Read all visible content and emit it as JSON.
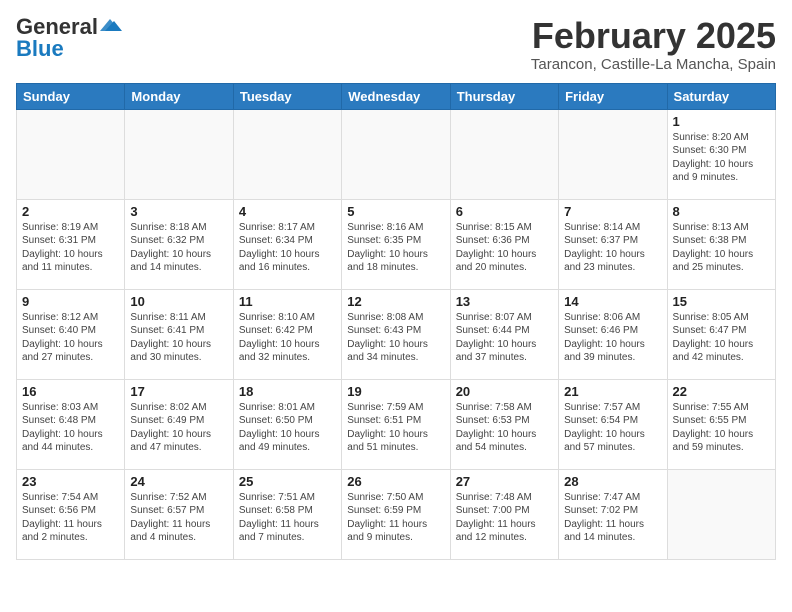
{
  "header": {
    "logo_general": "General",
    "logo_blue": "Blue",
    "month_year": "February 2025",
    "location": "Tarancon, Castille-La Mancha, Spain"
  },
  "weekdays": [
    "Sunday",
    "Monday",
    "Tuesday",
    "Wednesday",
    "Thursday",
    "Friday",
    "Saturday"
  ],
  "weeks": [
    [
      {
        "day": "",
        "info": ""
      },
      {
        "day": "",
        "info": ""
      },
      {
        "day": "",
        "info": ""
      },
      {
        "day": "",
        "info": ""
      },
      {
        "day": "",
        "info": ""
      },
      {
        "day": "",
        "info": ""
      },
      {
        "day": "1",
        "info": "Sunrise: 8:20 AM\nSunset: 6:30 PM\nDaylight: 10 hours and 9 minutes."
      }
    ],
    [
      {
        "day": "2",
        "info": "Sunrise: 8:19 AM\nSunset: 6:31 PM\nDaylight: 10 hours and 11 minutes."
      },
      {
        "day": "3",
        "info": "Sunrise: 8:18 AM\nSunset: 6:32 PM\nDaylight: 10 hours and 14 minutes."
      },
      {
        "day": "4",
        "info": "Sunrise: 8:17 AM\nSunset: 6:34 PM\nDaylight: 10 hours and 16 minutes."
      },
      {
        "day": "5",
        "info": "Sunrise: 8:16 AM\nSunset: 6:35 PM\nDaylight: 10 hours and 18 minutes."
      },
      {
        "day": "6",
        "info": "Sunrise: 8:15 AM\nSunset: 6:36 PM\nDaylight: 10 hours and 20 minutes."
      },
      {
        "day": "7",
        "info": "Sunrise: 8:14 AM\nSunset: 6:37 PM\nDaylight: 10 hours and 23 minutes."
      },
      {
        "day": "8",
        "info": "Sunrise: 8:13 AM\nSunset: 6:38 PM\nDaylight: 10 hours and 25 minutes."
      }
    ],
    [
      {
        "day": "9",
        "info": "Sunrise: 8:12 AM\nSunset: 6:40 PM\nDaylight: 10 hours and 27 minutes."
      },
      {
        "day": "10",
        "info": "Sunrise: 8:11 AM\nSunset: 6:41 PM\nDaylight: 10 hours and 30 minutes."
      },
      {
        "day": "11",
        "info": "Sunrise: 8:10 AM\nSunset: 6:42 PM\nDaylight: 10 hours and 32 minutes."
      },
      {
        "day": "12",
        "info": "Sunrise: 8:08 AM\nSunset: 6:43 PM\nDaylight: 10 hours and 34 minutes."
      },
      {
        "day": "13",
        "info": "Sunrise: 8:07 AM\nSunset: 6:44 PM\nDaylight: 10 hours and 37 minutes."
      },
      {
        "day": "14",
        "info": "Sunrise: 8:06 AM\nSunset: 6:46 PM\nDaylight: 10 hours and 39 minutes."
      },
      {
        "day": "15",
        "info": "Sunrise: 8:05 AM\nSunset: 6:47 PM\nDaylight: 10 hours and 42 minutes."
      }
    ],
    [
      {
        "day": "16",
        "info": "Sunrise: 8:03 AM\nSunset: 6:48 PM\nDaylight: 10 hours and 44 minutes."
      },
      {
        "day": "17",
        "info": "Sunrise: 8:02 AM\nSunset: 6:49 PM\nDaylight: 10 hours and 47 minutes."
      },
      {
        "day": "18",
        "info": "Sunrise: 8:01 AM\nSunset: 6:50 PM\nDaylight: 10 hours and 49 minutes."
      },
      {
        "day": "19",
        "info": "Sunrise: 7:59 AM\nSunset: 6:51 PM\nDaylight: 10 hours and 51 minutes."
      },
      {
        "day": "20",
        "info": "Sunrise: 7:58 AM\nSunset: 6:53 PM\nDaylight: 10 hours and 54 minutes."
      },
      {
        "day": "21",
        "info": "Sunrise: 7:57 AM\nSunset: 6:54 PM\nDaylight: 10 hours and 57 minutes."
      },
      {
        "day": "22",
        "info": "Sunrise: 7:55 AM\nSunset: 6:55 PM\nDaylight: 10 hours and 59 minutes."
      }
    ],
    [
      {
        "day": "23",
        "info": "Sunrise: 7:54 AM\nSunset: 6:56 PM\nDaylight: 11 hours and 2 minutes."
      },
      {
        "day": "24",
        "info": "Sunrise: 7:52 AM\nSunset: 6:57 PM\nDaylight: 11 hours and 4 minutes."
      },
      {
        "day": "25",
        "info": "Sunrise: 7:51 AM\nSunset: 6:58 PM\nDaylight: 11 hours and 7 minutes."
      },
      {
        "day": "26",
        "info": "Sunrise: 7:50 AM\nSunset: 6:59 PM\nDaylight: 11 hours and 9 minutes."
      },
      {
        "day": "27",
        "info": "Sunrise: 7:48 AM\nSunset: 7:00 PM\nDaylight: 11 hours and 12 minutes."
      },
      {
        "day": "28",
        "info": "Sunrise: 7:47 AM\nSunset: 7:02 PM\nDaylight: 11 hours and 14 minutes."
      },
      {
        "day": "",
        "info": ""
      }
    ]
  ]
}
